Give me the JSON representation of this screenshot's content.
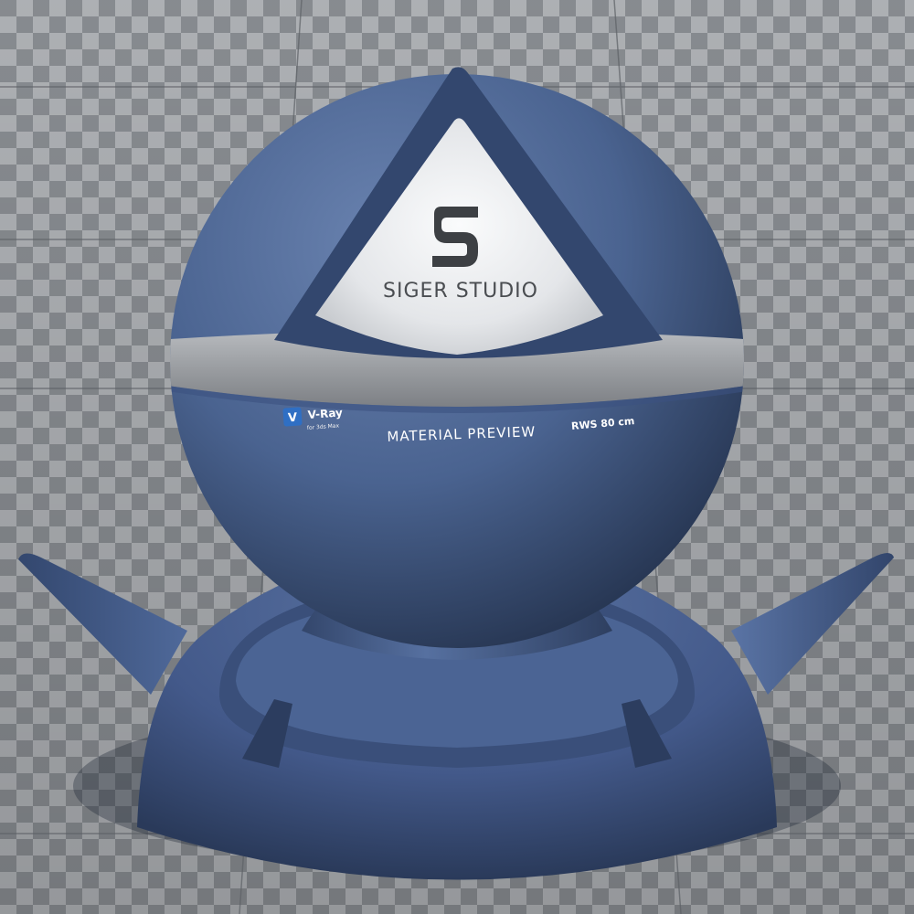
{
  "scene": {
    "material_color": "#4a6390",
    "material_shadow": "#26344f",
    "material_highlight": "#6d86b3",
    "checker_light": "#b9bcbf",
    "checker_dark": "#8f9398",
    "band_color": "#9c9fa3"
  },
  "logo": {
    "mark": "S",
    "studio_name": "SIGER STUDIO"
  },
  "band": {
    "vray_brand": "V-Ray",
    "vray_sub": "for 3ds Max",
    "vray_icon": "vray-icon",
    "title": "MATERIAL PREVIEW",
    "scale": "RWS 80 cm"
  }
}
